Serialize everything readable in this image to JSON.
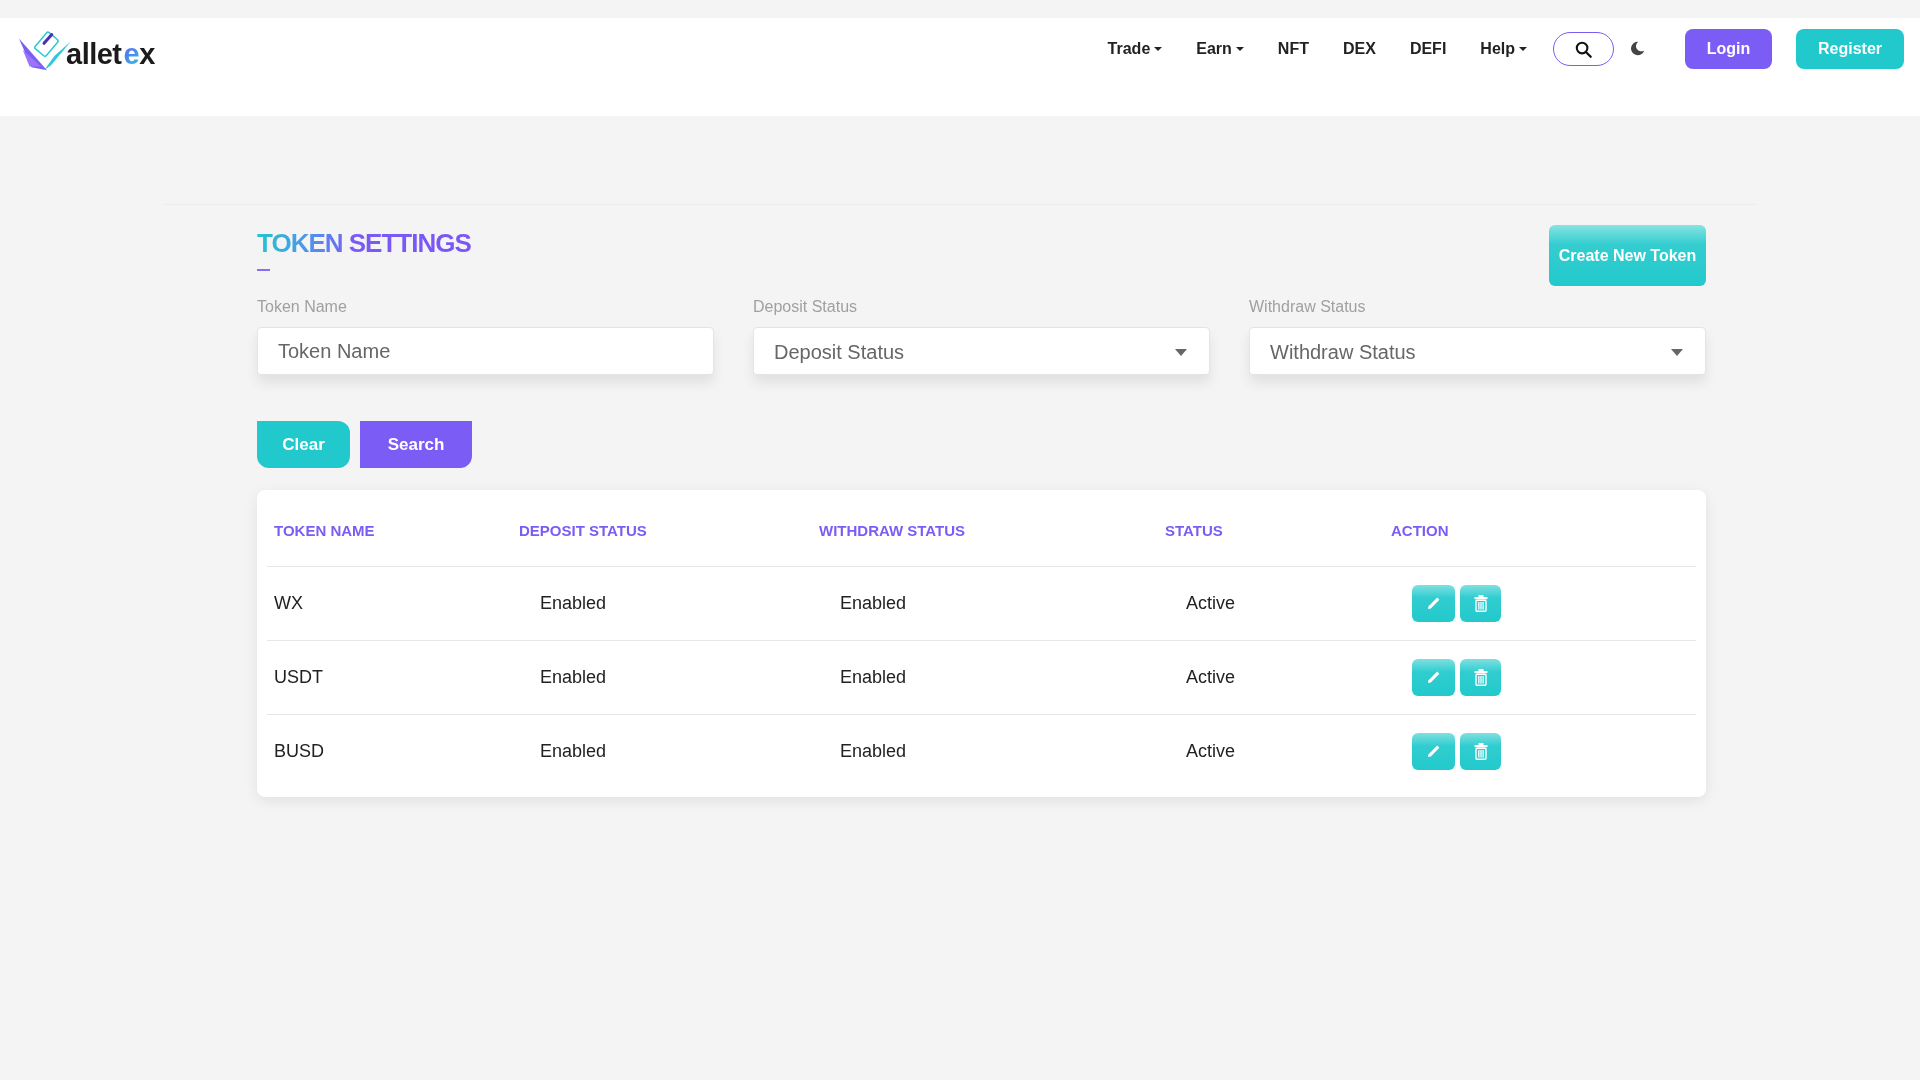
{
  "header": {
    "logo": {
      "segments": [
        {
          "text": "allet",
          "kind": "plain"
        },
        {
          "text": "e",
          "kind": "accent"
        },
        {
          "text": "x",
          "kind": "plain"
        }
      ]
    },
    "nav": [
      {
        "label": "Trade",
        "dropdown": true
      },
      {
        "label": "Earn",
        "dropdown": true
      },
      {
        "label": "NFT",
        "dropdown": false
      },
      {
        "label": "DEX",
        "dropdown": false
      },
      {
        "label": "DEFI",
        "dropdown": false
      },
      {
        "label": "Help",
        "dropdown": true
      }
    ],
    "buttons": [
      {
        "label": "Login",
        "kind": "primary"
      },
      {
        "label": "Register",
        "kind": "secondary"
      }
    ]
  },
  "page": {
    "title": "TOKEN SETTINGS",
    "create_button": "Create New Token",
    "filters": [
      {
        "label": "Token Name",
        "kind": "input",
        "placeholder": "Token Name"
      },
      {
        "label": "Deposit Status",
        "kind": "select",
        "placeholder": "Deposit Status"
      },
      {
        "label": "Withdraw Status",
        "kind": "select",
        "placeholder": "Withdraw Status"
      }
    ],
    "filter_buttons": [
      {
        "label": "Clear",
        "kind": "clear"
      },
      {
        "label": "Search",
        "kind": "search"
      }
    ],
    "table": {
      "columns": [
        "TOKEN NAME",
        "DEPOSIT STATUS",
        "WITHDRAW STATUS",
        "STATUS",
        "ACTION"
      ],
      "rows": [
        {
          "cells": [
            "WX",
            "Enabled",
            "Enabled",
            "Active"
          ]
        },
        {
          "cells": [
            "USDT",
            "Enabled",
            "Enabled",
            "Active"
          ]
        },
        {
          "cells": [
            "BUSD",
            "Enabled",
            "Enabled",
            "Active"
          ]
        }
      ]
    }
  }
}
